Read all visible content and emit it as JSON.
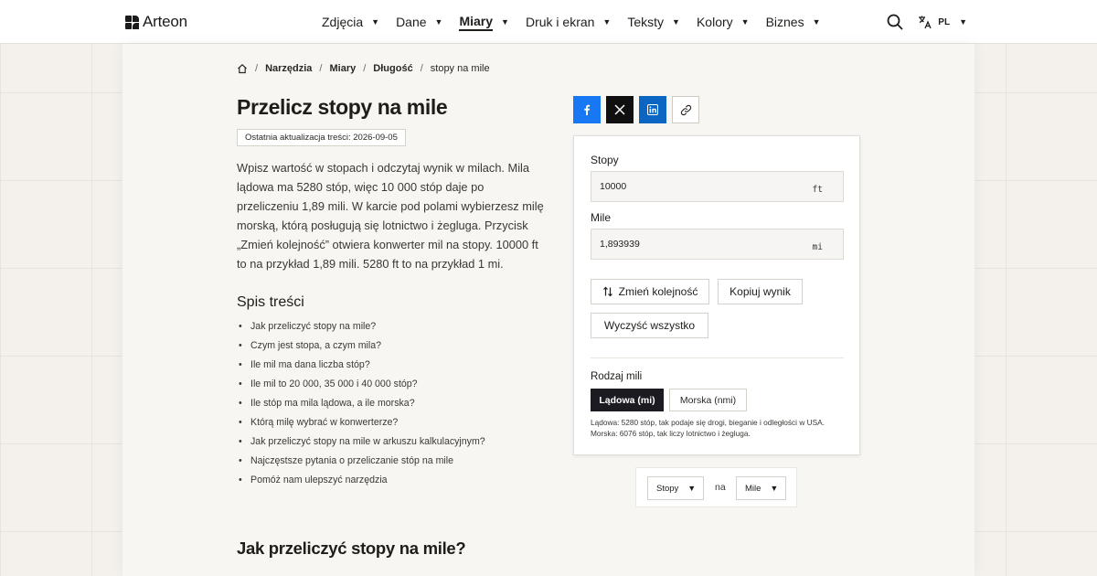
{
  "brand": {
    "name": "Arteon"
  },
  "nav": {
    "items": [
      {
        "label": "Zdjęcia"
      },
      {
        "label": "Dane"
      },
      {
        "label": "Miary"
      },
      {
        "label": "Druk i ekran"
      },
      {
        "label": "Teksty"
      },
      {
        "label": "Kolory"
      },
      {
        "label": "Biznes"
      }
    ],
    "active_index": 2,
    "language": "PL"
  },
  "breadcrumb": [
    "Narzędzia",
    "Miary",
    "Długość",
    "stopy na mile"
  ],
  "page": {
    "title": "Przelicz stopy na mile",
    "updated": "Ostatnia aktualizacja treści: 2026-09-05",
    "intro": "Wpisz wartość w stopach i odczytaj wynik w milach. Mila lądowa ma 5280 stóp, więc 10 000 stóp daje po przeliczeniu 1,89 mili. W karcie pod polami wybierzesz milę morską, którą posługują się lotnictwo i żegluga. Przycisk „Zmień kolejność” otwiera konwerter mil na stopy. 10000 ft to na przykład 1,89 mili. 5280 ft to na przykład 1 mi.",
    "toc_title": "Spis treści",
    "toc": [
      "Jak przeliczyć stopy na mile?",
      "Czym jest stopa, a czym mila?",
      "Ile mil ma dana liczba stóp?",
      "Ile mil to 20 000, 35 000 i 40 000 stóp?",
      "Ile stóp ma mila lądowa, a ile morska?",
      "Którą milę wybrać w konwerterze?",
      "Jak przeliczyć stopy na mile w arkuszu kalkulacyjnym?",
      "Najczęstsze pytania o przeliczanie stóp na mile",
      "Pomóż nam ulepszyć narzędzia"
    ],
    "section_heading": "Jak przeliczyć stopy na mile?"
  },
  "share": {
    "icons": [
      "facebook-icon",
      "x-icon",
      "linkedin-icon",
      "link-icon"
    ],
    "colors": {
      "facebook": "#1877f2",
      "x": "#0f0f0f",
      "linkedin": "#0a66c2"
    }
  },
  "converter": {
    "from_label": "Stopy",
    "from_value": "10000",
    "from_unit": "ft",
    "to_label": "Mile",
    "to_value": "1,893939",
    "to_unit": "mi",
    "swap_label": "Zmień kolejność",
    "copy_label": "Kopiuj wynik",
    "clear_label": "Wyczyść wszystko",
    "mode_label": "Rodzaj mili",
    "modes": [
      "Lądowa (mi)",
      "Morska (nmi)"
    ],
    "active_mode": 0,
    "note": "Lądowa: 5280 stóp, tak podaje się drogi, bieganie i odległości w USA. Morska: 6076 stóp, tak liczy lotnictwo i żegluga."
  },
  "unit_switch": {
    "from": "Stopy",
    "separator": "na",
    "to": "Mile"
  }
}
